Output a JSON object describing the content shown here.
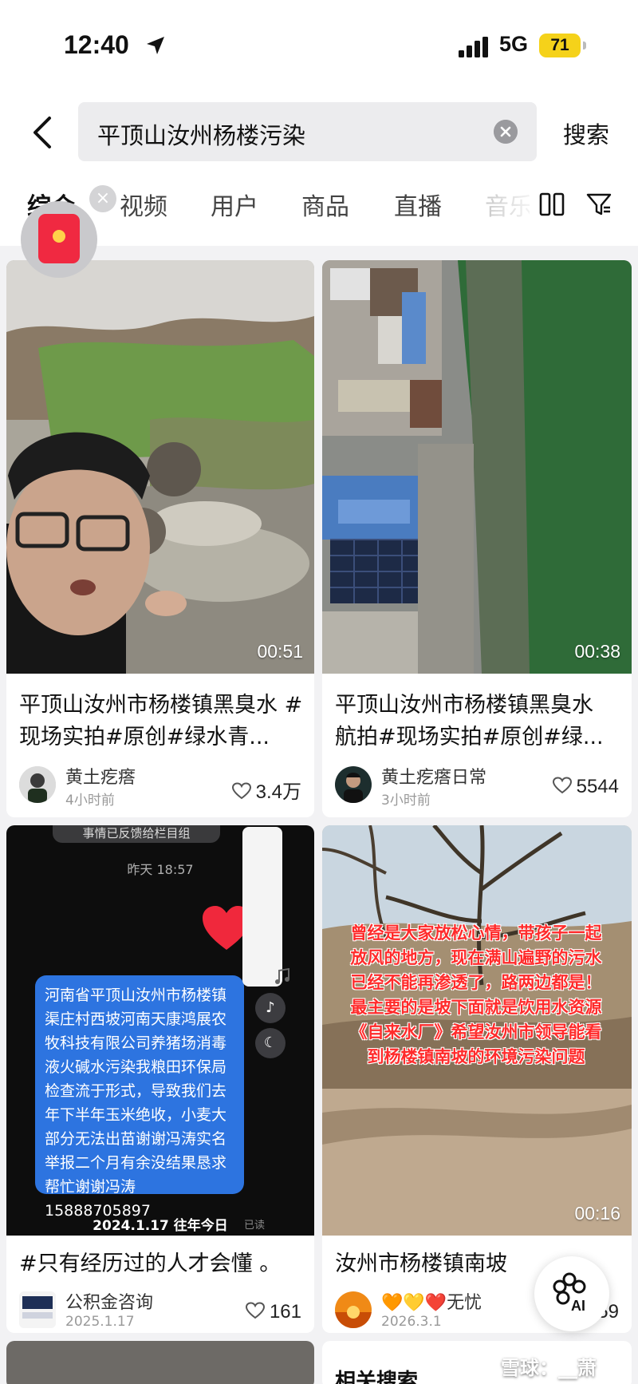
{
  "status_bar": {
    "time": "12:40",
    "network": "5G",
    "battery": "71"
  },
  "search": {
    "query": "平顶山汝州杨楼污染",
    "submit_label": "搜索"
  },
  "tabs": [
    "综合",
    "视频",
    "用户",
    "商品",
    "直播",
    "音乐"
  ],
  "cards": [
    {
      "title": "平顶山汝州市杨楼镇黑臭水 #现场实拍#原创#绿水青...",
      "duration": "00:51",
      "author": "黄土疙瘩",
      "posted": "4小时前",
      "likes": "3.4万"
    },
    {
      "title": "平顶山汝州市杨楼镇黑臭水 航拍#现场实拍#原创#绿...",
      "duration": "00:38",
      "author": "黄土疙瘩日常",
      "posted": "3小时前",
      "likes": "5544"
    },
    {
      "title": "#只有经历过的人才会懂 。",
      "chat_top": "事情已反馈给栏目组",
      "chat_time": "昨天 18:57",
      "chat_message": "河南省平顶山汝州市杨楼镇渠庄村西坡河南天康鸿展农牧科技有限公司养猪场消毒液火碱水污染我粮田环保局检查流于形式，导致我们去年下半年玉米绝收，小麦大部分无法出苗谢谢冯涛实名举报二个月有余没结果恳求帮忙谢谢冯涛15888705897",
      "chat_footer": "2024.1.17 往年今日",
      "chat_read": "已读",
      "author": "公积金咨询",
      "posted": "2025.1.17",
      "likes": "161"
    },
    {
      "title": "汝州市杨楼镇南坡",
      "overlay": "曾经是大家放松心情，带孩子一起放风的地方，现在满山遍野的污水已经不能再渗透了，路两边都是！最主要的是坡下面就是饮用水资源《自来水厂》希望汝州市领导能看到杨楼镇南坡的环境污染问题",
      "duration": "00:16",
      "author": "🧡💛❤️无忧",
      "posted": "2026.3.1",
      "likes": "59"
    }
  ],
  "ai_button": "AI",
  "watermark": "雪球：__萧",
  "related": "相关搜索"
}
